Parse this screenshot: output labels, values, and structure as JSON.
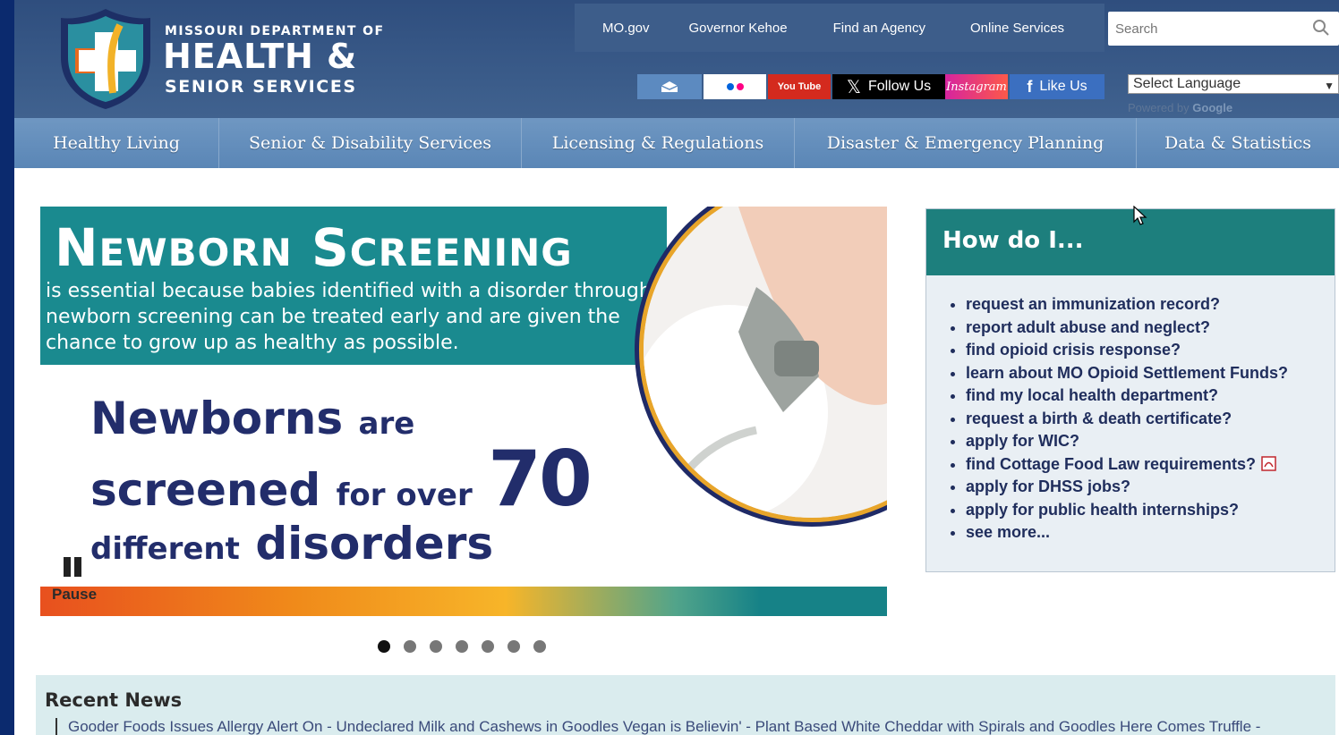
{
  "header": {
    "logo_line1": "MISSOURI DEPARTMENT OF",
    "logo_line2": "HEALTH &",
    "logo_line3": "SENIOR SERVICES"
  },
  "toplinks": [
    "MO.gov",
    "Governor Kehoe",
    "Find an Agency",
    "Online Services"
  ],
  "search": {
    "placeholder": "Search"
  },
  "social": {
    "youtube": "You Tube",
    "x_follow": "Follow Us",
    "instagram": "Instagram",
    "facebook": "Like Us"
  },
  "language": {
    "selected": "Select Language",
    "powered_prefix": "Powered by",
    "powered_brand": "Google"
  },
  "nav": [
    "Healthy Living",
    "Senior & Disability Services",
    "Licensing & Regulations",
    "Disaster & Emergency Planning",
    "Data & Statistics"
  ],
  "banner": {
    "title_n": "N",
    "title_ewborn": "EWBORN",
    "title_s": "S",
    "title_creening": "CREENING",
    "subtitle": "is essential because babies identified with a disorder through newborn screening can be treated early and are given the chance to grow up as healthy as possible.",
    "w_newborns": "Newborns",
    "w_are": "are",
    "w_screened": "screened",
    "w_for_over": "for over",
    "w_70": "70",
    "w_different": "different",
    "w_disorders": "disorders",
    "pause_label": "Pause"
  },
  "carousel": {
    "slide_count": 7,
    "active_index": 0
  },
  "howdo": {
    "title": "How do I...",
    "items": [
      "request an immunization record?",
      "report adult abuse and neglect?",
      "find opioid crisis response?",
      "learn about MO Opioid Settlement Funds?",
      "find my local health department?",
      "request a birth & death certificate?",
      "apply for WIC?",
      "find Cottage Food Law requirements?",
      "apply for DHSS jobs?",
      "apply for public health internships?",
      "see more..."
    ]
  },
  "news": {
    "title": "Recent News",
    "first_item": "Gooder Foods Issues Allergy Alert On - Undeclared Milk and Cashews in Goodles Vegan is Believin' - Plant Based White Cheddar with Spirals and Goodles Here Comes Truffle -"
  },
  "colors": {
    "header_bg": "#2f4e7e",
    "nav_bg": "#5a86b6",
    "teal": "#1a8a8f",
    "navy_text": "#222d6b",
    "howdo_head": "#1d7f7d"
  }
}
